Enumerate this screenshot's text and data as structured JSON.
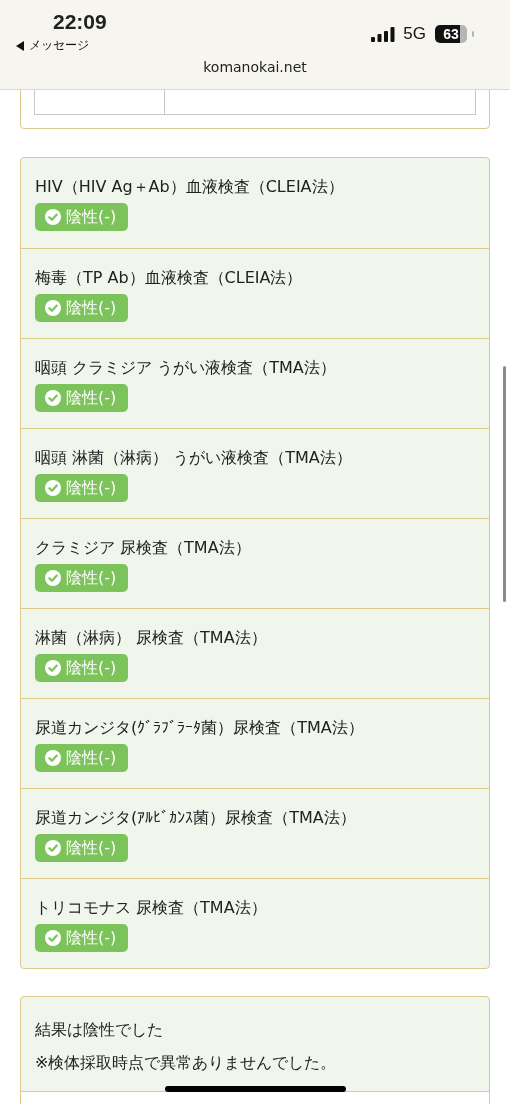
{
  "status_bar": {
    "time": "22:09",
    "back_label": "メッセージ",
    "network": "5G",
    "battery": "63"
  },
  "address_bar": {
    "url": "komanokai.net"
  },
  "results": [
    {
      "test": "HIV（HIV Ag＋Ab）血液検査（CLEIA法）",
      "result": "陰性(-)",
      "kind": "negative"
    },
    {
      "test": "梅毒（TP Ab）血液検査（CLEIA法）",
      "result": "陰性(-)",
      "kind": "negative"
    },
    {
      "test": "咽頭 クラミジア うがい液検査（TMA法）",
      "result": "陰性(-)",
      "kind": "negative"
    },
    {
      "test": "咽頭 淋菌（淋病） うがい液検査（TMA法）",
      "result": "陰性(-)",
      "kind": "negative"
    },
    {
      "test": "クラミジア 尿検査（TMA法）",
      "result": "陰性(-)",
      "kind": "negative"
    },
    {
      "test": "淋菌（淋病） 尿検査（TMA法）",
      "result": "陰性(-)",
      "kind": "negative"
    },
    {
      "test": "尿道カンジタ(ｸﾞﾗﾌﾞﾗｰﾀ菌）尿検査（TMA法）",
      "result": "陰性(-)",
      "kind": "negative"
    },
    {
      "test": "尿道カンジタ(ｱﾙﾋﾞｶﾝｽ菌）尿検査（TMA法）",
      "result": "陰性(-)",
      "kind": "negative"
    },
    {
      "test": "トリコモナス 尿検査（TMA法）",
      "result": "陰性(-)",
      "kind": "negative"
    }
  ],
  "summary": {
    "lines": [
      "結果は陰性でした",
      "※検体採取時点で異常ありませんでした。"
    ]
  }
}
